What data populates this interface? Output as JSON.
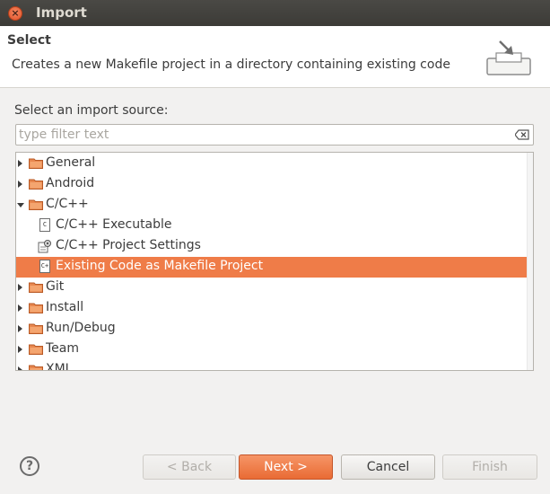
{
  "window": {
    "title": "Import"
  },
  "header": {
    "title": "Select",
    "description": "Creates a new Makefile project in a directory containing existing code",
    "banner_icon": "import-wizard-icon"
  },
  "source": {
    "label": "Select an import source:",
    "filter_placeholder": "type filter text",
    "filter_value": ""
  },
  "tree": {
    "items": [
      {
        "label": "General",
        "type": "folder",
        "expanded": false
      },
      {
        "label": "Android",
        "type": "folder",
        "expanded": false
      },
      {
        "label": "C/C++",
        "type": "folder",
        "expanded": true
      },
      {
        "label": "C/C++ Executable",
        "type": "file",
        "icon_glyph": "C"
      },
      {
        "label": "C/C++ Project Settings",
        "type": "settings"
      },
      {
        "label": "Existing Code as Makefile Project",
        "type": "file",
        "icon_glyph": "C+",
        "selected": true
      },
      {
        "label": "Git",
        "type": "folder",
        "expanded": false
      },
      {
        "label": "Install",
        "type": "folder",
        "expanded": false
      },
      {
        "label": "Run/Debug",
        "type": "folder",
        "expanded": false
      },
      {
        "label": "Team",
        "type": "folder",
        "expanded": false
      },
      {
        "label": "XML",
        "type": "folder",
        "expanded": false
      }
    ]
  },
  "buttons": {
    "help": "?",
    "back": "< Back",
    "next": "Next >",
    "cancel": "Cancel",
    "finish": "Finish"
  },
  "colors": {
    "selection": "#ef7c48",
    "folder": "#e8874f",
    "titlebar": "#3c3b37"
  }
}
